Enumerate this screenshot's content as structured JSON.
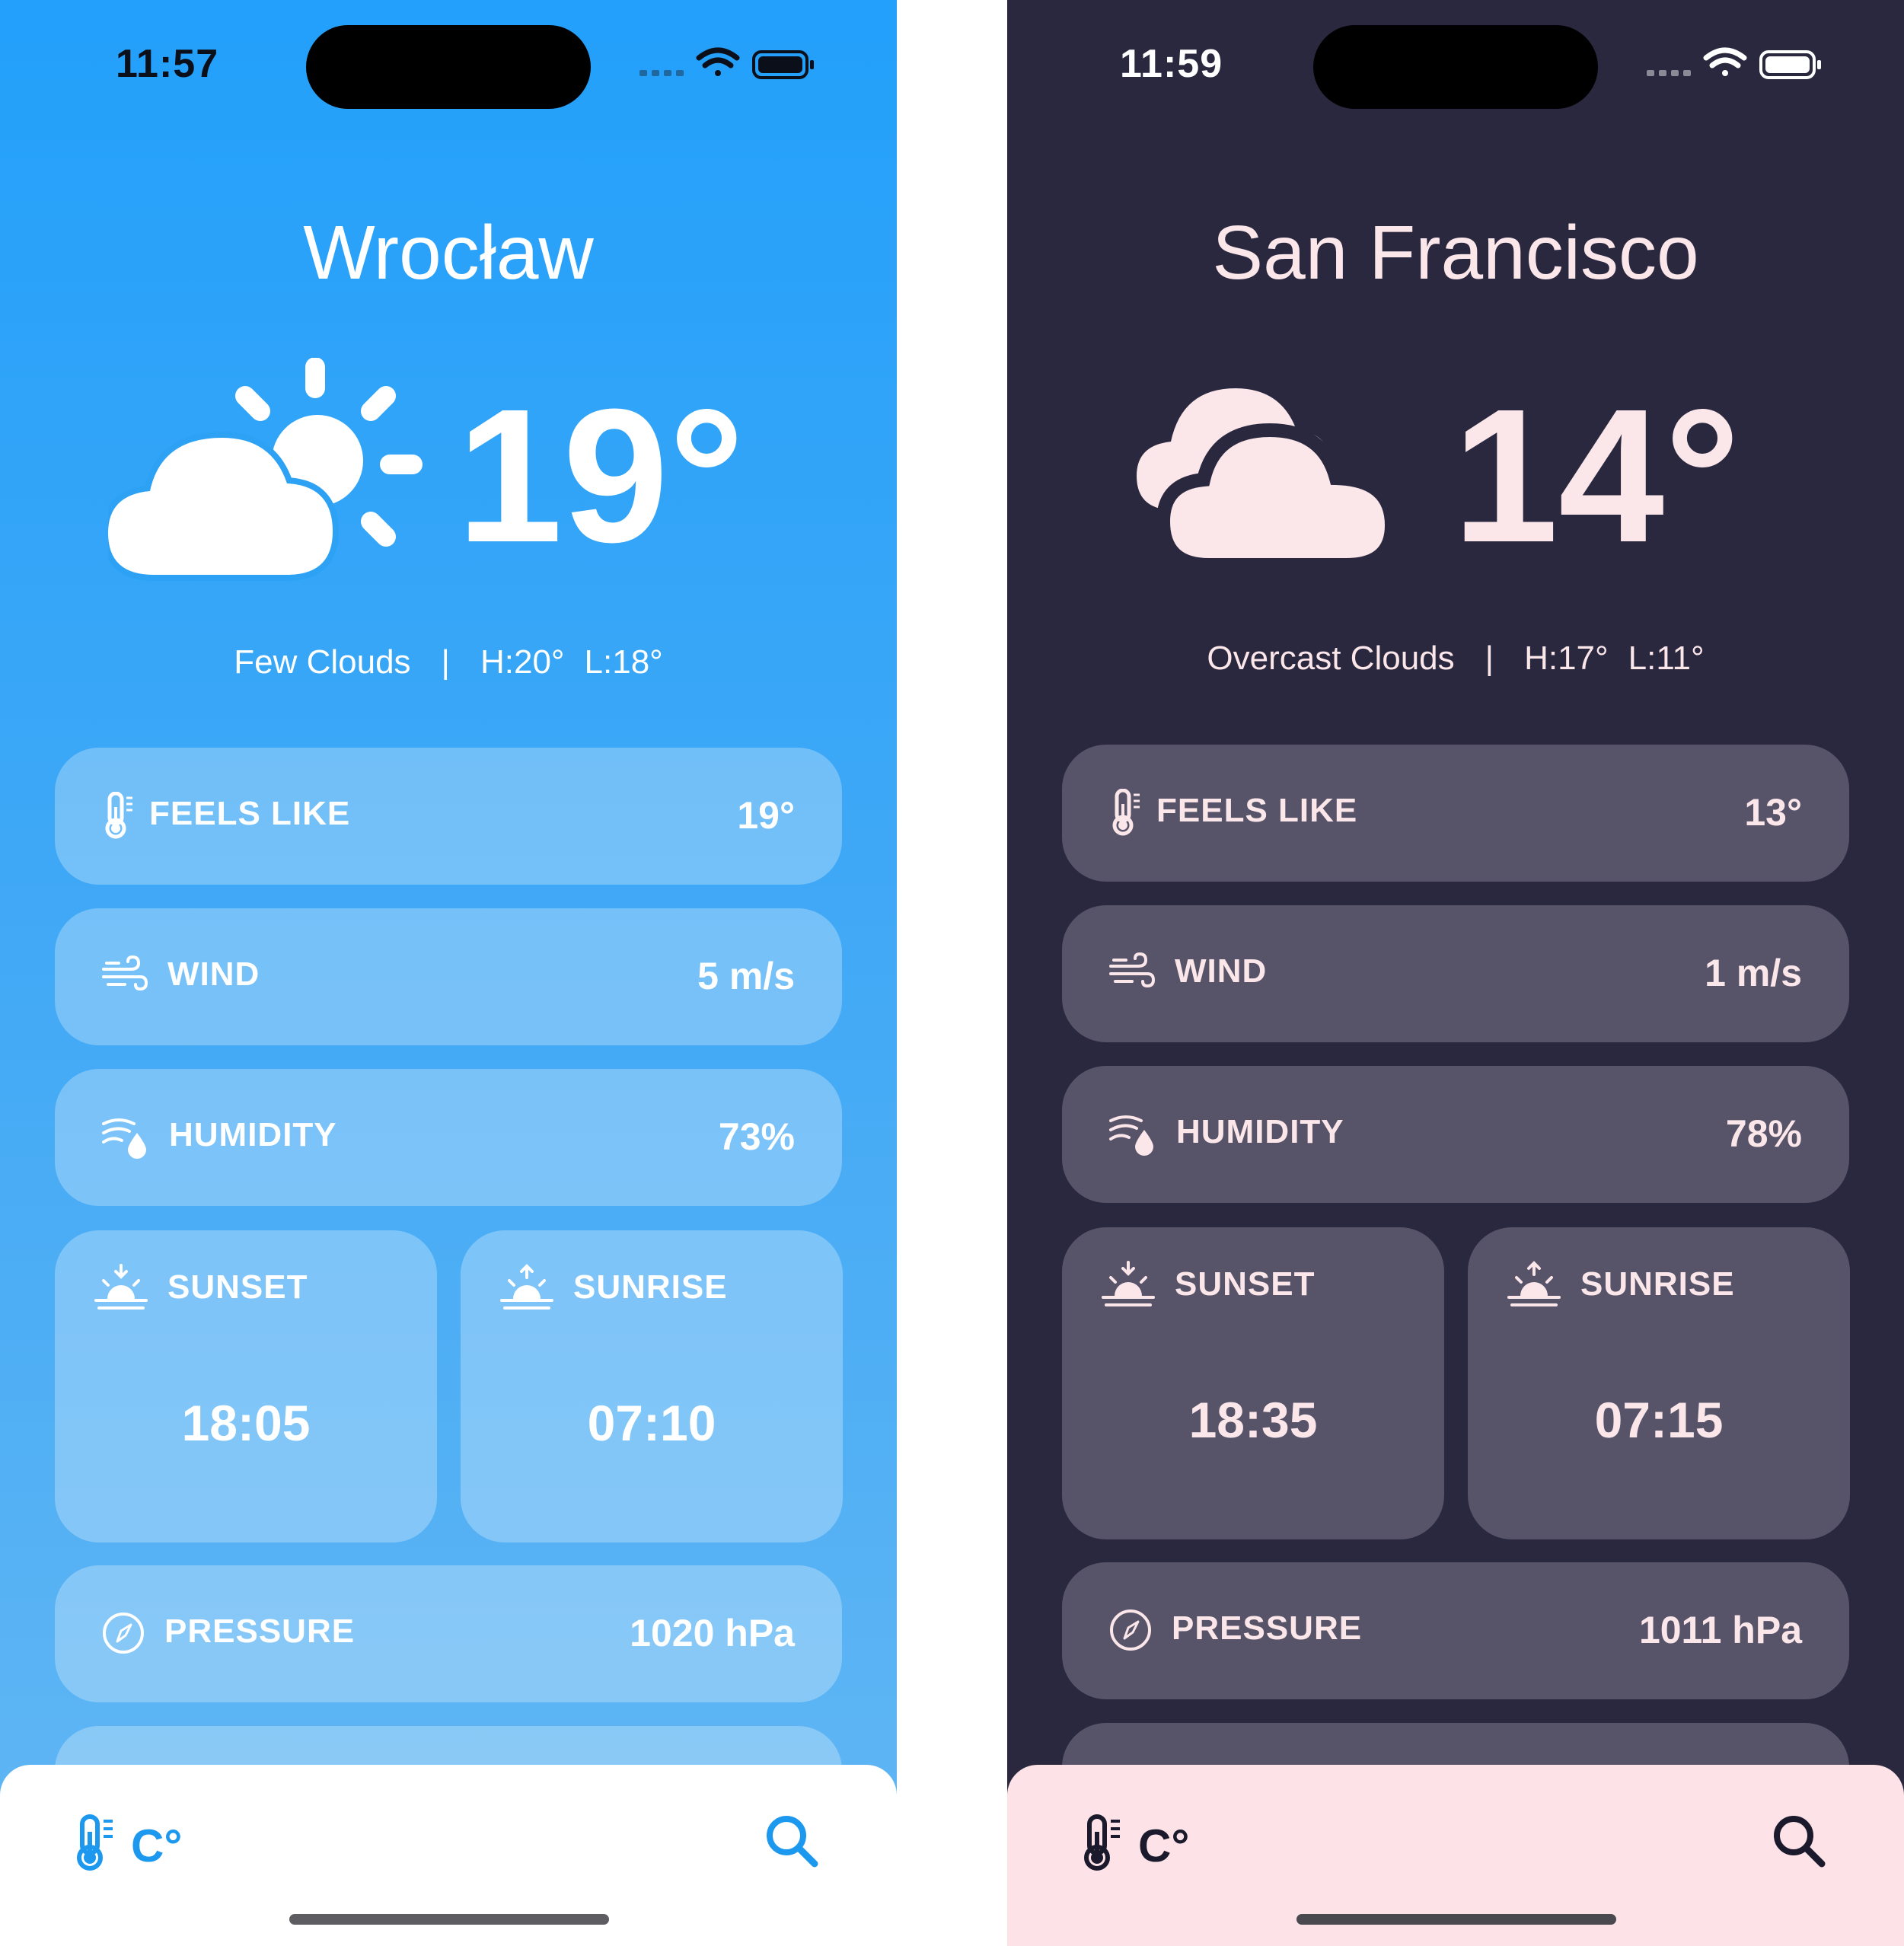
{
  "colors": {
    "light_gradient_top": "#22a0fb",
    "light_gradient_bottom": "#63b7f3",
    "dark_background": "#2a283e",
    "dark_card": "#575469",
    "dark_text": "#fbe6ea",
    "light_accent": "#1d98ef",
    "dark_tabbar": "#fde3e7"
  },
  "phones": [
    {
      "theme": "light",
      "status_time": "11:57",
      "city": "Wrocław",
      "weather_icon": "cloud-sun-icon",
      "temperature": "19°",
      "condition": "Few Clouds",
      "separator": "|",
      "high": "H:20°",
      "low": "L:18°",
      "feels_like": {
        "label": "FEELS LIKE",
        "value": "19°"
      },
      "wind": {
        "label": "WIND",
        "value": "5 m/s"
      },
      "humidity": {
        "label": "HUMIDITY",
        "value": "73%"
      },
      "sunset": {
        "label": "SUNSET",
        "value": "18:05"
      },
      "sunrise": {
        "label": "SUNRISE",
        "value": "07:10"
      },
      "pressure": {
        "label": "PRESSURE",
        "value": "1020 hPa"
      },
      "tabbar": {
        "unit_label": "C°"
      }
    },
    {
      "theme": "dark",
      "status_time": "11:59",
      "city": "San Francisco",
      "weather_icon": "clouds-icon",
      "temperature": "14°",
      "condition": "Overcast Clouds",
      "separator": "|",
      "high": "H:17°",
      "low": "L:11°",
      "feels_like": {
        "label": "FEELS LIKE",
        "value": "13°"
      },
      "wind": {
        "label": "WIND",
        "value": "1 m/s"
      },
      "humidity": {
        "label": "HUMIDITY",
        "value": "78%"
      },
      "sunset": {
        "label": "SUNSET",
        "value": "18:35"
      },
      "sunrise": {
        "label": "SUNRISE",
        "value": "07:15"
      },
      "pressure": {
        "label": "PRESSURE",
        "value": "1011 hPa"
      },
      "tabbar": {
        "unit_label": "C°"
      }
    }
  ]
}
